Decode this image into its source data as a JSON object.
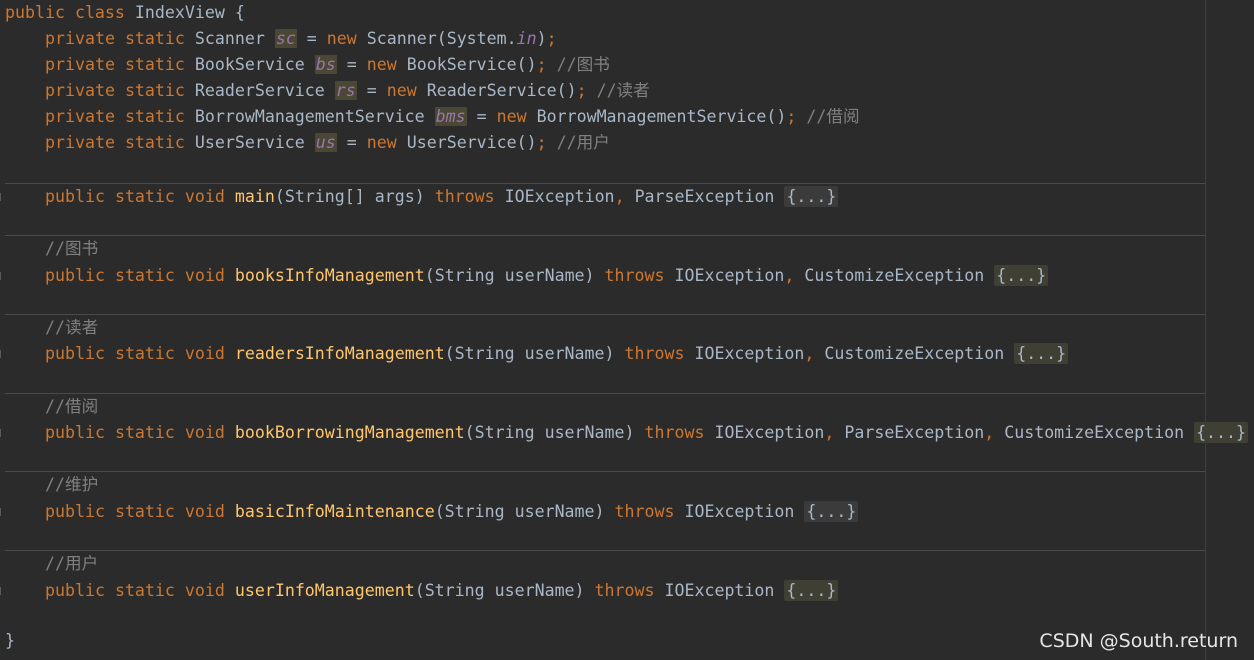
{
  "code": {
    "class_decl": {
      "kw1": "public",
      "kw2": "class",
      "name": "IndexView",
      "brace": "{"
    },
    "fields": [
      {
        "type": "Scanner",
        "var": "sc",
        "ctor": "Scanner(System.",
        "ctor_field": "in",
        "ctor_end": ")",
        "comment": ""
      },
      {
        "type": "BookService",
        "var": "bs",
        "ctor": "BookService()",
        "ctor_field": "",
        "ctor_end": "",
        "comment": "//图书"
      },
      {
        "type": "ReaderService",
        "var": "rs",
        "ctor": "ReaderService()",
        "ctor_field": "",
        "ctor_end": "",
        "comment": "//读者"
      },
      {
        "type": "BorrowManagementService",
        "var": "bms",
        "ctor": "BorrowManagementService()",
        "ctor_field": "",
        "ctor_end": "",
        "comment": "//借阅"
      },
      {
        "type": "UserService",
        "var": "us",
        "ctor": "UserService()",
        "ctor_field": "",
        "ctor_end": "",
        "comment": "//用户"
      }
    ],
    "methods": [
      {
        "comment": "",
        "name": "main",
        "params": "(String[] args)",
        "exceptions": [
          "IOException",
          "ParseException"
        ],
        "fold": "{...}"
      },
      {
        "comment": "//图书",
        "name": "booksInfoManagement",
        "params": "(String userName)",
        "exceptions": [
          "IOException",
          "CustomizeException"
        ],
        "fold": "{...}"
      },
      {
        "comment": "//读者",
        "name": "readersInfoManagement",
        "params": "(String userName)",
        "exceptions": [
          "IOException",
          "CustomizeException"
        ],
        "fold": "{...}"
      },
      {
        "comment": "//借阅",
        "name": "bookBorrowingManagement",
        "params": "(String userName)",
        "exceptions": [
          "IOException",
          "ParseException",
          "CustomizeException"
        ],
        "fold": "{...}"
      },
      {
        "comment": "//维护",
        "name": "basicInfoMaintenance",
        "params": "(String userName)",
        "exceptions": [
          "IOException"
        ],
        "fold": "{...}"
      },
      {
        "comment": "//用户",
        "name": "userInfoManagement",
        "params": "(String userName)",
        "exceptions": [
          "IOException"
        ],
        "fold": "{...}"
      }
    ],
    "closing_brace": "}",
    "kw": {
      "private": "private",
      "static": "static",
      "new": "new",
      "public": "public",
      "void": "void",
      "throws": "throws",
      "eq": "=",
      "semi": ";"
    }
  },
  "watermark": "CSDN @South.return",
  "colors": {
    "background": "#2b2b2b",
    "keyword": "#cc7832",
    "method": "#ffc66d",
    "field": "#9876aa",
    "comment": "#808080",
    "text": "#a9b7c6"
  }
}
